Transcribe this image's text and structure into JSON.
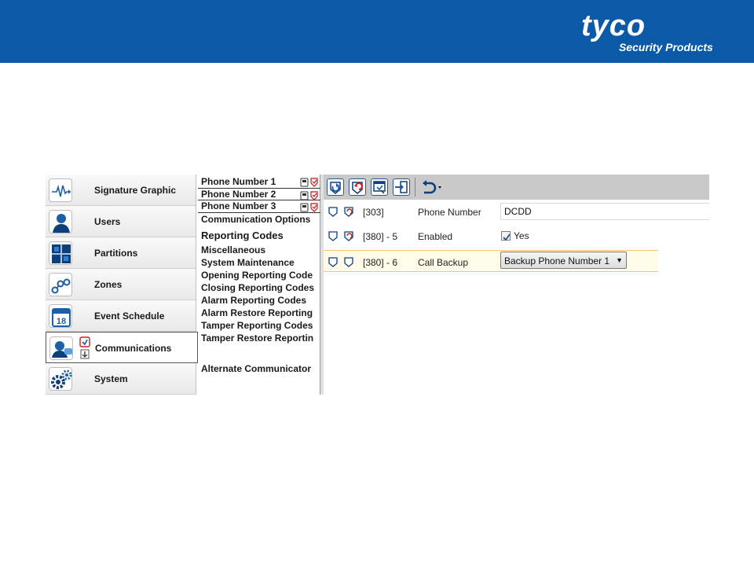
{
  "brand": {
    "name": "tyco",
    "tagline": "Security Products"
  },
  "nav": {
    "items": [
      {
        "label": "Signature Graphic",
        "icon": "signature-graphic-icon"
      },
      {
        "label": "Users",
        "icon": "users-icon"
      },
      {
        "label": "Partitions",
        "icon": "partitions-icon"
      },
      {
        "label": "Zones",
        "icon": "zones-icon"
      },
      {
        "label": "Event Schedule",
        "icon": "event-schedule-icon",
        "badge": "18"
      },
      {
        "label": "Communications",
        "icon": "communications-icon",
        "active": true
      },
      {
        "label": "System",
        "icon": "system-icon"
      }
    ]
  },
  "sublist": {
    "phone_numbers": [
      "Phone Number 1",
      "Phone Number 2",
      "Phone Number 3"
    ],
    "communication_options": "Communication Options",
    "reporting_codes_header": "Reporting Codes",
    "reporting_items": [
      "Miscellaneous",
      "System Maintenance",
      "Opening  Reporting Code",
      "Closing Reporting Codes",
      "Alarm Reporting Codes",
      "Alarm Restore Reporting",
      "Tamper Reporting Codes",
      "Tamper  Restore Reportin"
    ],
    "alternate_communicator": "Alternate Communicator"
  },
  "toolbar": {
    "buttons": [
      "read-icon",
      "write-icon",
      "compare-icon",
      "transfer-icon",
      "undo-icon"
    ]
  },
  "rows": [
    {
      "code": "[303]",
      "label": "Phone Number",
      "value": "DCDD"
    },
    {
      "code": "[380] - 5",
      "label": "Enabled",
      "checked": true,
      "value": "Yes"
    },
    {
      "code": "[380] - 6",
      "label": "Call Backup",
      "value": "Backup Phone Number 1"
    }
  ],
  "colors": {
    "header": "#0b5aa8",
    "accent": "#2b5a8f",
    "highlight_row": "#fffbe8"
  }
}
